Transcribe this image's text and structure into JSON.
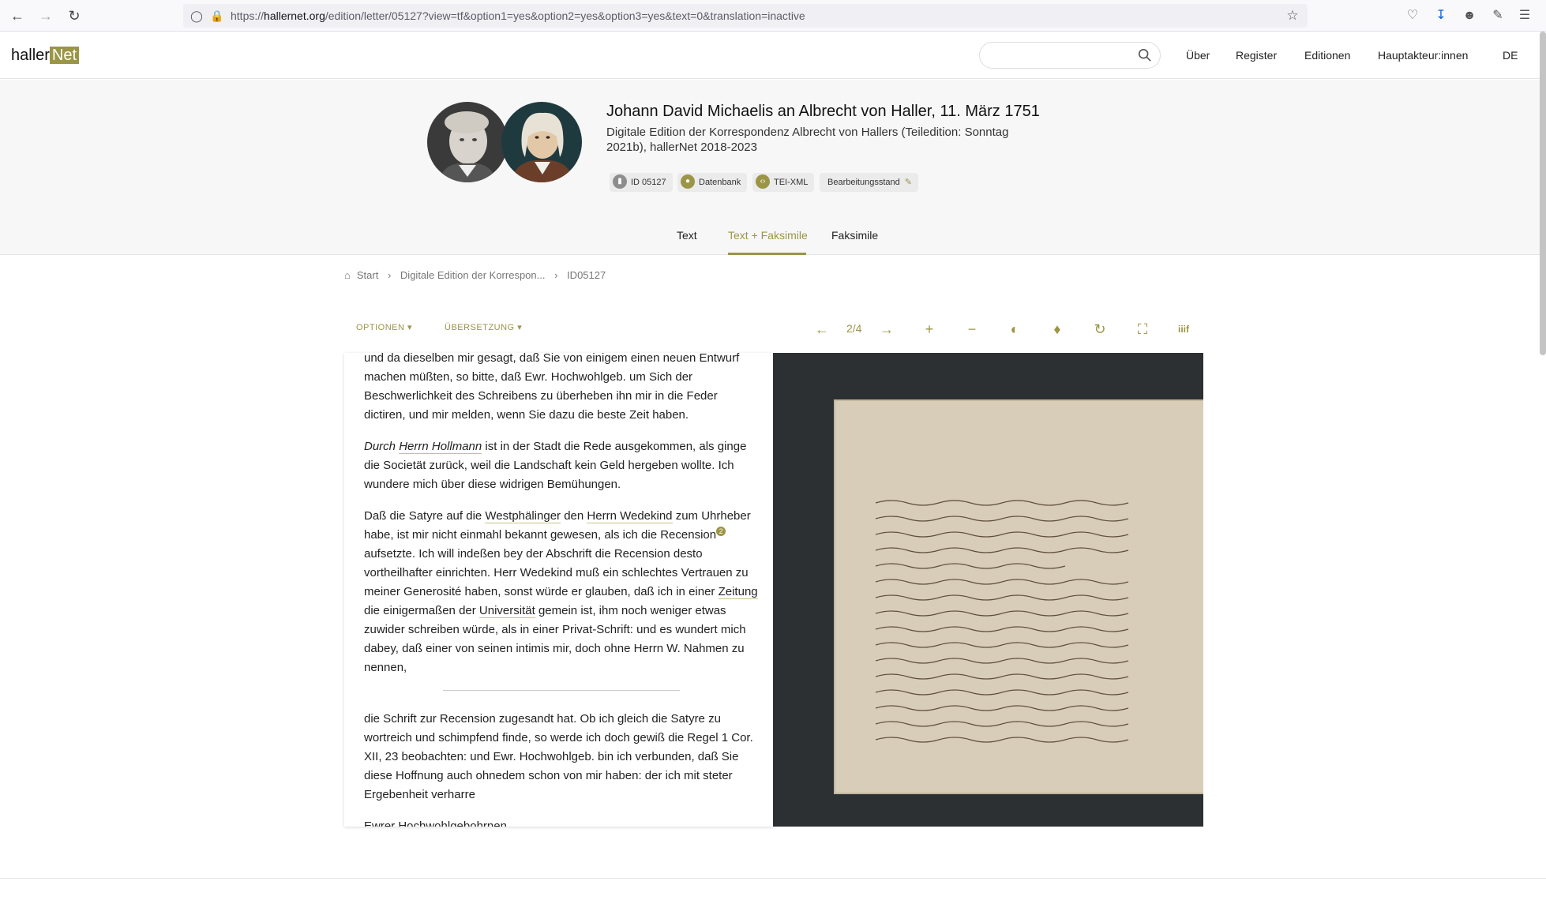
{
  "browser": {
    "url_prefix": "https://",
    "url_host": "hallernet.org",
    "url_path": "/edition/letter/05127?view=tf&option1=yes&option2=yes&option3=yes&text=0&translation=inactive"
  },
  "header": {
    "logo_part1": "haller",
    "logo_part2": "Net",
    "search_placeholder": "",
    "nav": [
      "Über",
      "Register",
      "Editionen",
      "Hauptakteur:innen",
      "DE"
    ]
  },
  "letter": {
    "title": "Johann David Michaelis an Albrecht von Haller, 11. März 1751",
    "subtitle": "Digitale Edition der Korrespondenz Albrecht von Hallers (Teiledition: Sonntag 2021b), hallerNet 2018-2023",
    "badges": [
      "ID 05127",
      "Datenbank",
      "TEI-XML",
      "Bearbeitungsstand"
    ]
  },
  "tabs": [
    "Text",
    "Text + Faksimile",
    "Faksimile"
  ],
  "breadcrumb": [
    "Start",
    "Digitale Edition der Korrespon...",
    "ID05127"
  ],
  "toolbar": {
    "options_label": "OPTIONEN",
    "translation_label": "ÜBERSETZUNG",
    "page_indicator": "2/4"
  },
  "text": {
    "p1": "und da dieselben mir gesagt, daß Sie von einigem einen neuen Entwurf machen müßten, so bitte, daß Ewr. Hochwohlgeb. um Sich der Beschwerlichkeit des Schreibens zu überheben ihn mir in die Feder dictiren, und mir melden, wenn Sie dazu die beste Zeit haben.",
    "p2_a": "Durch",
    "p2_b": "Herrn Hollmann",
    "p2_c": " ist in der Stadt die Rede ausgekommen, als ginge die Societät zurück, weil die Landschaft kein Geld hergeben wollte. Ich wundere mich über diese widrigen Bemühungen.",
    "p3_a": "Daß die Satyre auf die ",
    "p3_b": "Westphälinger",
    "p3_c": " den ",
    "p3_d": "Herrn Wedekind",
    "p3_e": " zum Uhrheber habe, ist mir nicht einmahl bekannt gewesen, als ich die Recension",
    "p3_note": "2",
    "p3_f": " aufsetzte. Ich will indeßen bey der Abschrift die Recension desto vortheilhafter einrichten. Herr Wedekind muß ein schlechtes Vertrauen zu meiner Generosité haben, sonst würde er glauben, daß ich in einer ",
    "p3_g": "Zeitung",
    "p3_h": " die einigermaßen der ",
    "p3_i": "Universität",
    "p3_j": " gemein ist, ihm noch weniger etwas zuwider schreiben würde, als in einer Privat-Schrift: und es wundert mich dabey, daß einer von seinen intimis mir, doch ohne Herrn W. Nahmen zu nennen,",
    "p4": "die Schrift zur Recension zugesandt hat. Ob ich gleich die Satyre zu wortreich und schimpfend finde, so werde ich doch gewiß die Regel 1 Cor. XII, 23 beobachten: und Ewr. Hochwohlgeb. bin ich verbunden, daß Sie diese Hoffnung auch ohnedem schon von mir haben: der ich mit steter Ergebenheit verharre",
    "p5": "Ewrer Hochwohlgebohrnen"
  },
  "colors": {
    "accent": "#9b9546",
    "facsimile_bg": "#2d3033",
    "paper": "#d8cdb8"
  }
}
